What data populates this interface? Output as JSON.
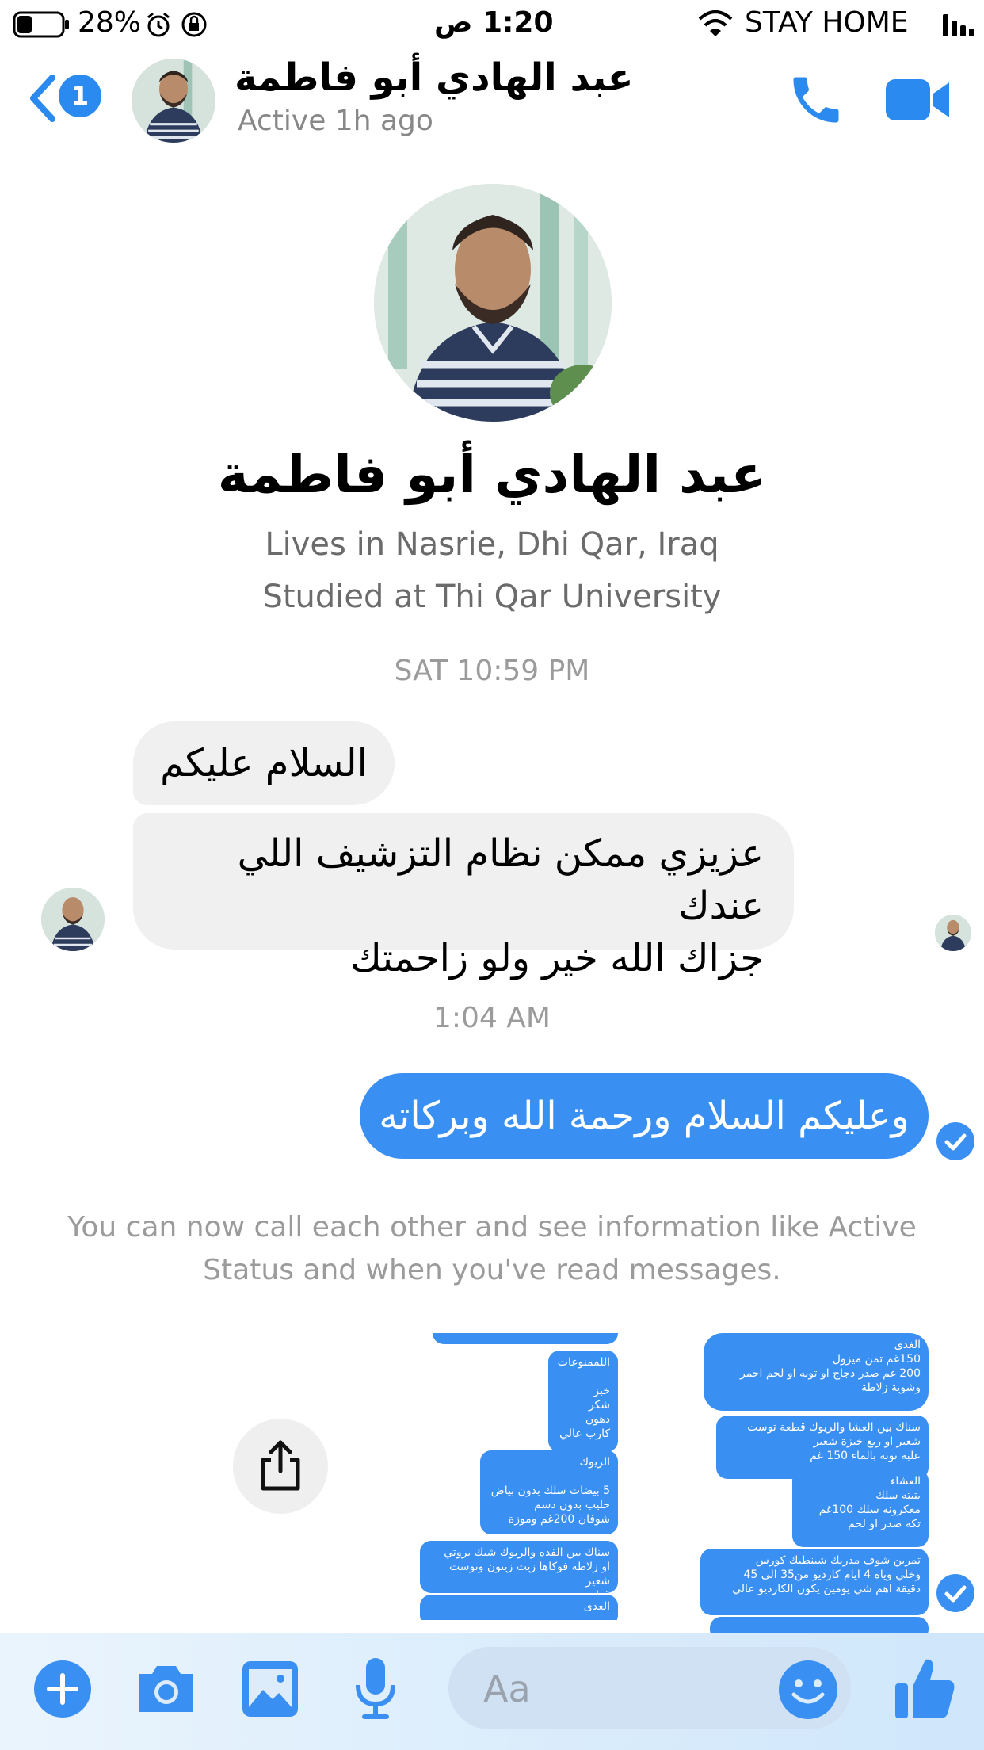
{
  "status_bar": {
    "battery": "28%",
    "time": "1:20 ص",
    "carrier": "STAY HOME"
  },
  "header": {
    "back_badge": "1",
    "name": "عبد الهادي أبو فاطمة",
    "status": "Active 1h ago"
  },
  "profile": {
    "name": "عبد الهادي أبو فاطمة",
    "location": "Lives in Nasrie, Dhi Qar, Iraq",
    "education": "Studied at Thi Qar University"
  },
  "conversation": {
    "timestamp_1": "SAT 10:59 PM",
    "msg_in_1": "السلام عليكم",
    "msg_in_2": "عزيزي ممكن نظام التزشيف اللي عندك\nجزاك الله خير ولو زاحمتك",
    "timestamp_2": "1:04 AM",
    "msg_out_1": "وعليكم السلام ورحمة الله وبركاته",
    "info_text": "You can now call each other and see information like Active Status and when you've read messages."
  },
  "attachments": {
    "left_shot": [
      "اللممنوعات\n\nخبز\nشكر\nدهون\nكارب عالي",
      "الريوك\n\n5 بيضات سلك بدون بياض\nحليب بدون دسم\nشوفان 200غم وموزة",
      "سناك بين الفده والريوك شيك بروتي\nاو زلاطة فوكاها زيت زيتون وتوست شعير\nقطعة وحدة",
      "الغدى"
    ],
    "right_shot": [
      "الغدى\n150غم تمن ميزول\n200 غم صدر دجاج او تونه او لحم احمر\nوشوية زلاطة",
      "سناك بين العشا والريوك قطعة توست\nشعير او ربع خبزة شعير\nعلبة تونة بالماء 150 غم",
      "العشاء\nبتيته سلك\nمعكرونه سلك 100غم\nتكه صدر او لحم",
      "تمرين شوف مدربك شينطيك كورس\nوخلي وياه 4 ايام كارديو من35 الى 45\nدقيقة اهم شي يومين يكون الكارديو عالي"
    ]
  },
  "composer": {
    "placeholder": "Aa"
  },
  "colors": {
    "accent": "#3a8ff2",
    "incoming_bubble": "#f0f0f0"
  }
}
